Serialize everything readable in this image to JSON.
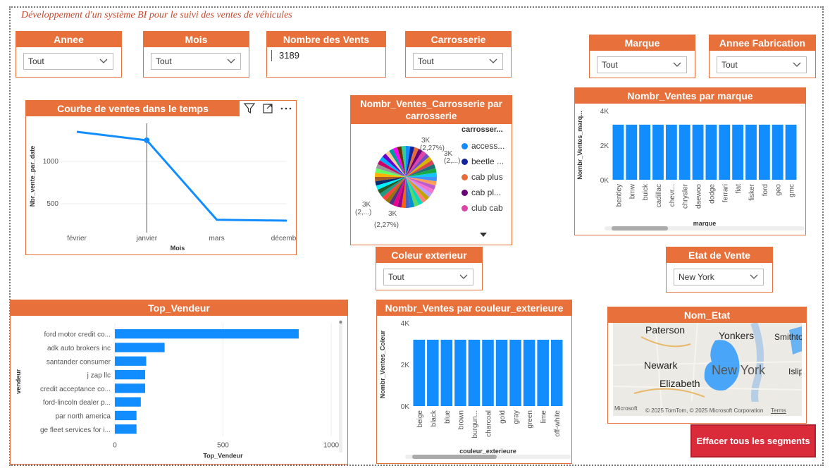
{
  "page_title": "Développement d'un système BI pour le suivi des ventes de véhicules",
  "filters": {
    "annee": {
      "label": "Annee",
      "value": "Tout"
    },
    "mois": {
      "label": "Mois",
      "value": "Tout"
    },
    "nombre_ventes": {
      "label": "Nombre des Vents",
      "value": "3189"
    },
    "carrosserie": {
      "label": "Carrosserie",
      "value": "Tout"
    },
    "marque": {
      "label": "Marque",
      "value": "Tout"
    },
    "annee_fab": {
      "label": "Annee Fabrication",
      "value": "Tout"
    },
    "couleur": {
      "label": "Coleur exterieur",
      "value": "Tout"
    },
    "etat": {
      "label": "Etat de Vente",
      "value": "New York"
    }
  },
  "line_chart": {
    "title": "Courbe de ventes dans le temps",
    "ylabel": "Nbr_vente_par_date",
    "xlabel": "Mois",
    "ticks_y": [
      "1000",
      "500"
    ]
  },
  "pie_chart": {
    "title": "Nombr_Ventes_Carrosserie par carrosserie",
    "legend_title": "carrosser...",
    "legend": [
      "access...",
      "beetle ...",
      "cab plus",
      "cab pl...",
      "club cab"
    ],
    "legend_colors": [
      "#118dff",
      "#12239e",
      "#e66c37",
      "#6b007b",
      "#e044a7"
    ],
    "labels": [
      "3K",
      "(2,27%)",
      "3K",
      "(2,...)",
      "3K",
      "(2,...)",
      "3K",
      "(2,27%)"
    ]
  },
  "brand_chart": {
    "title": "Nombr_Ventes par marque",
    "ylabel": "Nombr_Ventes_marq...",
    "xlabel": "marque",
    "ticks_y": [
      "4K",
      "2K",
      "0K"
    ]
  },
  "vendor_chart": {
    "title": "Top_Vendeur",
    "ylabel": "vendeur",
    "xlabel": "Top_Vendeur",
    "ticks_x": [
      "0",
      "500",
      "1000"
    ]
  },
  "color_chart": {
    "title": "Nombr_Ventes par couleur_exterieure",
    "ylabel": "Nombr_Ventes_Coleur",
    "xlabel": "couleur_exterieure",
    "ticks_y": [
      "4K",
      "2K",
      "0K"
    ]
  },
  "map": {
    "title": "Nom_Etat",
    "labels": [
      "Paterson",
      "Yonkers",
      "Smithto",
      "Newark",
      "New York",
      "Elizabeth",
      "Islip"
    ],
    "attribution": "© 2025 TomTom, © 2025 Microsoft Corporation",
    "terms": "Terms",
    "brand": "Microsoft"
  },
  "clear_button": "Effacer tous les segments",
  "chart_data": [
    {
      "type": "line",
      "title": "Courbe de ventes dans le temps",
      "xlabel": "Mois",
      "ylabel": "Nbr_vente_par_date",
      "categories": [
        "février",
        "janvier",
        "mars",
        "décembre"
      ],
      "values": [
        1350,
        1250,
        310,
        300
      ]
    },
    {
      "type": "bar",
      "title": "Nombr_Ventes par marque",
      "xlabel": "marque",
      "ylabel": "Nombr_Ventes_marq...",
      "ylim": [
        0,
        4000
      ],
      "categories": [
        "bentley",
        "bmw",
        "buick",
        "cadillac",
        "chevr...",
        "chrysler",
        "daewoo",
        "dodge",
        "ferrari",
        "fiat",
        "fisker",
        "ford",
        "geo",
        "gmc"
      ],
      "values": [
        3189,
        3189,
        3189,
        3189,
        3189,
        3189,
        3189,
        3189,
        3189,
        3189,
        3189,
        3189,
        3189,
        3189
      ]
    },
    {
      "type": "bar",
      "title": "Top_Vendeur",
      "xlabel": "Top_Vendeur",
      "ylabel": "vendeur",
      "xlim": [
        0,
        1000
      ],
      "categories": [
        "ford motor credit co...",
        "adk auto brokers inc",
        "santander consumer",
        "j zap llc",
        "credit acceptance co...",
        "ford-lincoln dealer p...",
        "par north america",
        "ge fleet services for i..."
      ],
      "values": [
        850,
        230,
        145,
        140,
        140,
        120,
        100,
        100
      ]
    },
    {
      "type": "bar",
      "title": "Nombr_Ventes par couleur_exterieure",
      "xlabel": "couleur_exterieure",
      "ylabel": "Nombr_Ventes_Coleur",
      "ylim": [
        0,
        4000
      ],
      "categories": [
        "beige",
        "black",
        "blue",
        "brown",
        "burgun...",
        "charcoal",
        "gold",
        "gray",
        "green",
        "lime",
        "off-white"
      ],
      "values": [
        3189,
        3189,
        3189,
        3189,
        3189,
        3189,
        3189,
        3189,
        3189,
        3189,
        3189
      ]
    },
    {
      "type": "pie",
      "title": "Nombr_Ventes_Carrosserie par carrosserie",
      "slices": 44,
      "each_percent": 2.27
    }
  ]
}
